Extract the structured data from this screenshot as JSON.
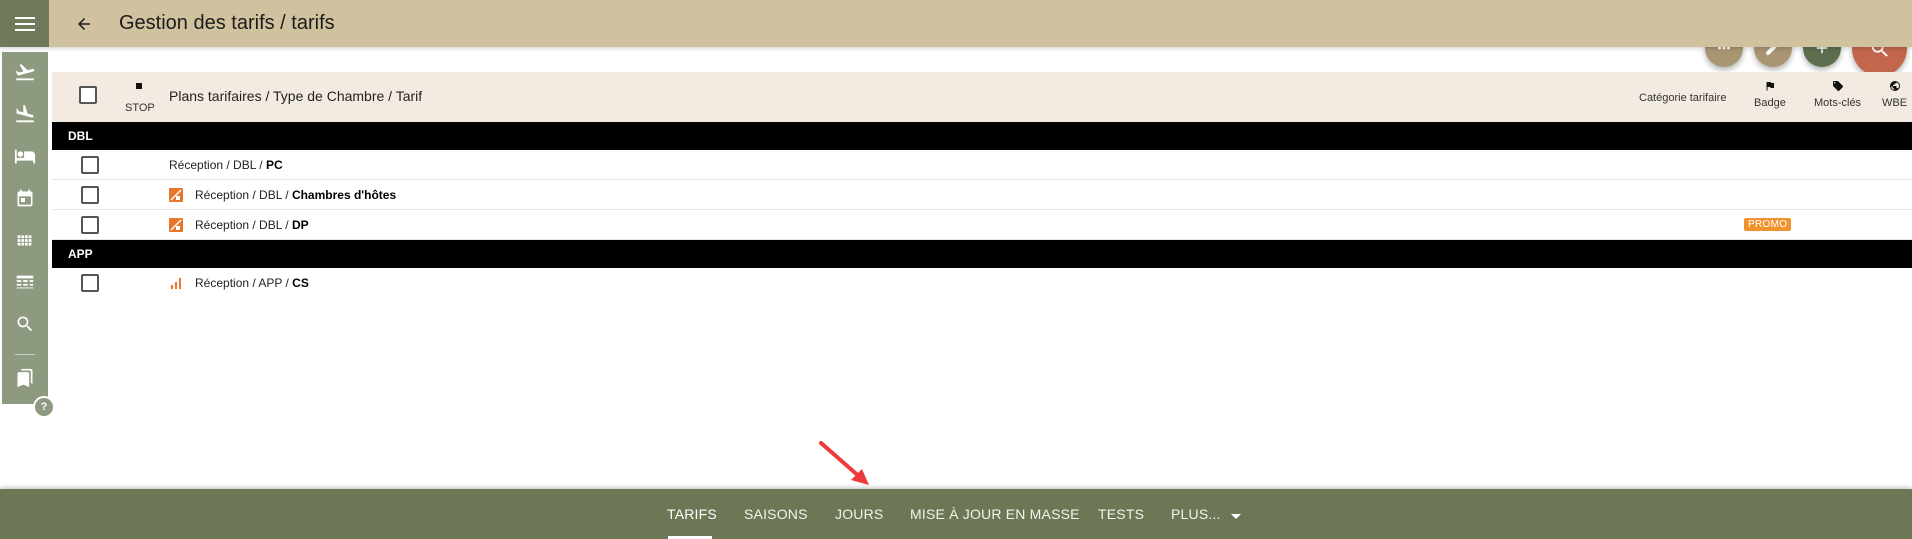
{
  "header": {
    "title": "Gestion des tarifs / tarifs"
  },
  "sidebar": {
    "items": [
      {
        "icon": "flight-takeoff-icon"
      },
      {
        "icon": "flight-land-icon"
      },
      {
        "icon": "bed-icon"
      },
      {
        "icon": "calendar-icon"
      },
      {
        "icon": "grid-icon"
      },
      {
        "icon": "table-icon"
      },
      {
        "icon": "search-icon"
      },
      {
        "icon": "bookmark-icon"
      }
    ],
    "help_label": "?"
  },
  "table": {
    "header": {
      "stop": "STOP",
      "main": "Plans tarifaires / Type de Chambre / Tarif",
      "categorie": "Catégorie tarifaire",
      "badge": "Badge",
      "mots_cles": "Mots-clés",
      "wbe": "WBE"
    },
    "groups": [
      {
        "name": "DBL",
        "rows": [
          {
            "path": "Réception / DBL / ",
            "tarif": "PC",
            "icon": "none",
            "badge": ""
          },
          {
            "path": "Réception / DBL / ",
            "tarif": "Chambres d'hôtes",
            "icon": "derived-rate-icon",
            "badge": ""
          },
          {
            "path": "Réception / DBL / ",
            "tarif": "DP",
            "icon": "derived-rate-icon",
            "badge": "PROMO"
          }
        ]
      },
      {
        "name": "APP",
        "rows": [
          {
            "path": "Réception / APP / ",
            "tarif": "CS",
            "icon": "bar-chart-icon",
            "badge": ""
          }
        ]
      }
    ]
  },
  "bottom_nav": {
    "tabs": [
      "TARIFS",
      "SAISONS",
      "JOURS",
      "MISE À JOUR EN MASSE",
      "TESTS",
      "PLUS..."
    ],
    "active": "TARIFS"
  },
  "colors": {
    "topbar": "#d1c29f",
    "sidebar": "#8e9a80",
    "bottombar": "#6c7756",
    "search_fab": "#c2674c",
    "promo_badge": "#f0932e",
    "accent_orange": "#e8762d"
  }
}
